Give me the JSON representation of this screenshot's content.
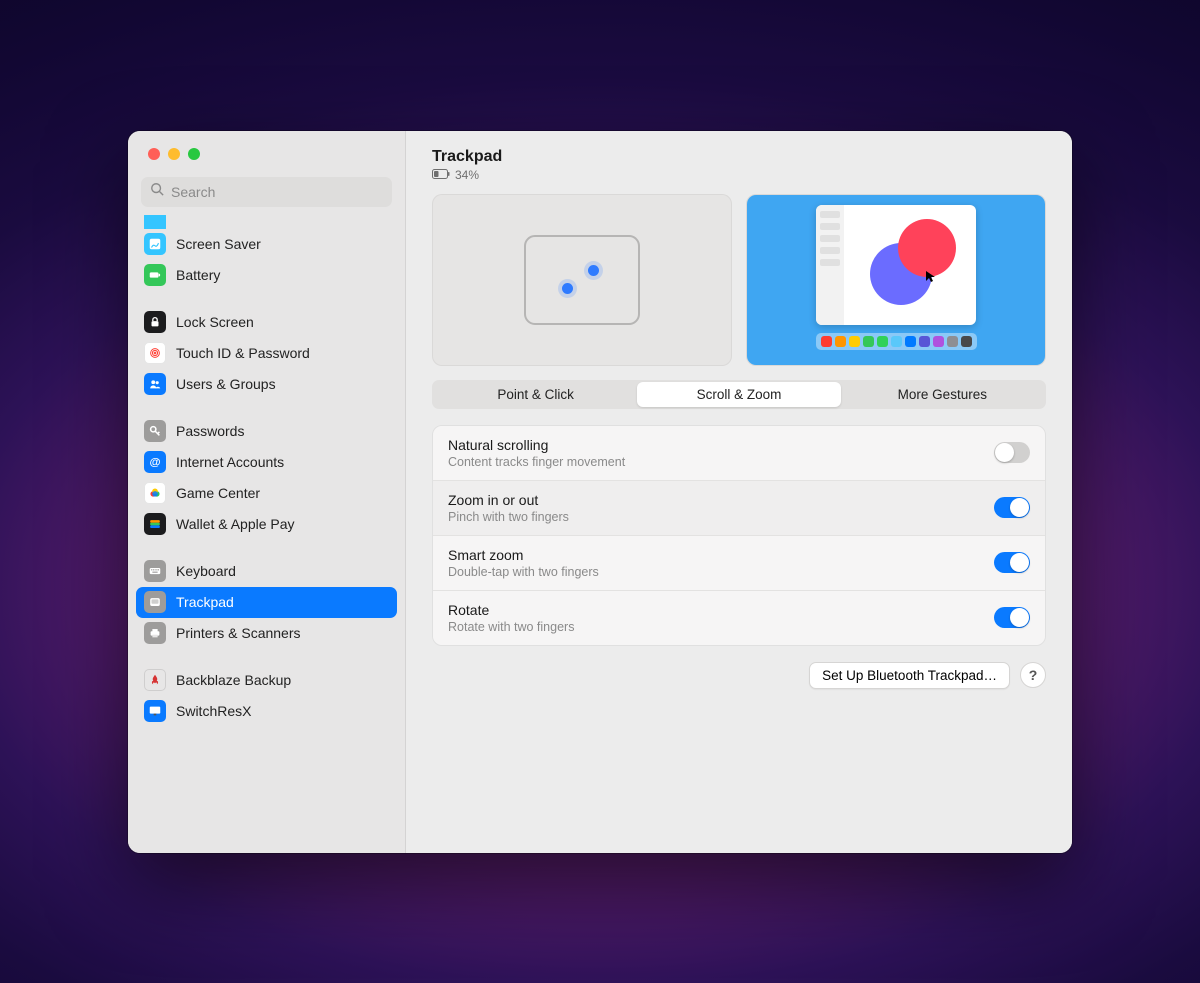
{
  "search": {
    "placeholder": "Search"
  },
  "header": {
    "title": "Trackpad",
    "battery_text": "34%"
  },
  "sidebar": {
    "groups": [
      {
        "items": [
          {
            "label": "Screen Saver",
            "icon": "screensaver",
            "bg": "#34c5ff",
            "fg": "#ffffff"
          },
          {
            "label": "Battery",
            "icon": "battery",
            "bg": "#34c759",
            "fg": "#ffffff"
          }
        ]
      },
      {
        "items": [
          {
            "label": "Lock Screen",
            "icon": "lock",
            "bg": "#1c1c1e",
            "fg": "#ffffff"
          },
          {
            "label": "Touch ID & Password",
            "icon": "fingerprint",
            "bg": "#ffffff",
            "fg": "#ff3b30"
          },
          {
            "label": "Users & Groups",
            "icon": "users",
            "bg": "#0a7aff",
            "fg": "#ffffff"
          }
        ]
      },
      {
        "items": [
          {
            "label": "Passwords",
            "icon": "key",
            "bg": "#9d9c9b",
            "fg": "#ffffff"
          },
          {
            "label": "Internet Accounts",
            "icon": "at",
            "bg": "#0a7aff",
            "fg": "#ffffff"
          },
          {
            "label": "Game Center",
            "icon": "gamecenter",
            "bg": "#ffffff",
            "fg": "#ff3b30"
          },
          {
            "label": "Wallet & Apple Pay",
            "icon": "wallet",
            "bg": "#1c1c1e",
            "fg": "#ffffff"
          }
        ]
      },
      {
        "items": [
          {
            "label": "Keyboard",
            "icon": "keyboard",
            "bg": "#9d9c9b",
            "fg": "#ffffff"
          },
          {
            "label": "Trackpad",
            "icon": "trackpad",
            "bg": "#9d9c9b",
            "fg": "#ffffff",
            "selected": true
          },
          {
            "label": "Printers & Scanners",
            "icon": "printer",
            "bg": "#9d9c9b",
            "fg": "#ffffff"
          }
        ]
      },
      {
        "items": [
          {
            "label": "Backblaze Backup",
            "icon": "backblaze",
            "bg": "transparent",
            "fg": "#d63333"
          },
          {
            "label": "SwitchResX",
            "icon": "switchresx",
            "bg": "#0a7aff",
            "fg": "#ffffff"
          }
        ]
      }
    ]
  },
  "tabs": [
    {
      "label": "Point & Click",
      "active": false
    },
    {
      "label": "Scroll & Zoom",
      "active": true
    },
    {
      "label": "More Gestures",
      "active": false
    }
  ],
  "settings": [
    {
      "title": "Natural scrolling",
      "sub": "Content tracks finger movement",
      "on": false
    },
    {
      "title": "Zoom in or out",
      "sub": "Pinch with two fingers",
      "on": true
    },
    {
      "title": "Smart zoom",
      "sub": "Double-tap with two fingers",
      "on": true
    },
    {
      "title": "Rotate",
      "sub": "Rotate with two fingers",
      "on": true
    }
  ],
  "footer": {
    "setup_button": "Set Up Bluetooth Trackpad…",
    "help_button": "?"
  },
  "dock_colors": [
    "#ff3b30",
    "#ff9500",
    "#ffcc00",
    "#34c759",
    "#30d158",
    "#5ac8fa",
    "#007aff",
    "#5856d6",
    "#af52de",
    "#8e8e93",
    "#48484a"
  ]
}
